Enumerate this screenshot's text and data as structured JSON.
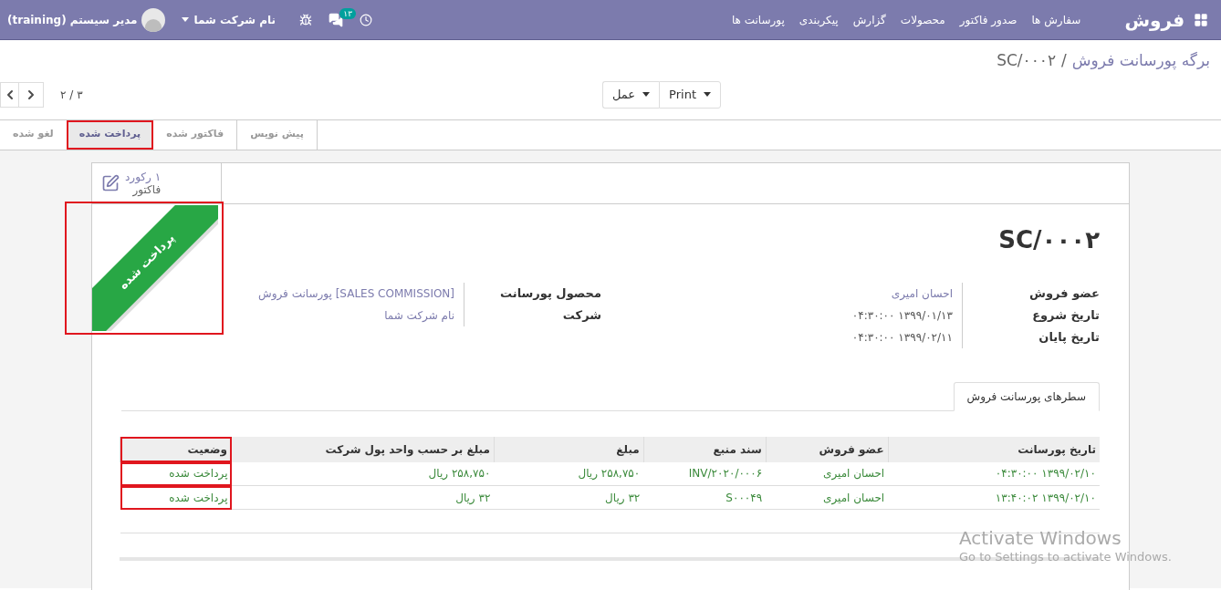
{
  "navbar": {
    "brand": "فروش",
    "menu": [
      "سفارش ها",
      "صدور فاکتور",
      "محصولات",
      "گزارش",
      "پیکربندی",
      "پورسانت ها"
    ],
    "messages_count": "۱۳",
    "company": "نام شرکت شما",
    "user": "مدیر سیستم (training)"
  },
  "breadcrumb": {
    "parent": "برگه پورسانت فروش",
    "separator": "/",
    "current": "SC/۰۰۰۲"
  },
  "actions": [
    {
      "label": "Print"
    },
    {
      "label": "عمل"
    }
  ],
  "pager": {
    "text": "۳ / ۲"
  },
  "status_steps": [
    {
      "label": "پیش نویس",
      "selected": false,
      "highlighted": false
    },
    {
      "label": "فاکتور شده",
      "selected": false,
      "highlighted": false
    },
    {
      "label": "پرداخت شده",
      "selected": true,
      "highlighted": true
    },
    {
      "label": "لغو شده",
      "selected": false,
      "highlighted": false
    }
  ],
  "smart_button": {
    "count": "۱ رکورد",
    "label": "فاکتور"
  },
  "ribbon": {
    "text": "پرداخت شده",
    "highlighted": true
  },
  "title": "SC/۰۰۰۲",
  "fields_right": [
    {
      "label": "عضو فروش",
      "value": "احسان امیری",
      "kind": "link"
    },
    {
      "label": "تاریخ شروع",
      "value": "۱۳۹۹/۰۱/۱۳ ۰۴:۳۰:۰۰",
      "kind": "text"
    },
    {
      "label": "تاریخ پایان",
      "value": "۱۳۹۹/۰۲/۱۱ ۰۴:۳۰:۰۰",
      "kind": "text"
    }
  ],
  "fields_left": [
    {
      "label": "محصول پورسانت",
      "value": "[SALES COMMISSION] پورسانت فروش",
      "kind": "link"
    },
    {
      "label": "شرکت",
      "value": "نام شرکت شما",
      "kind": "link"
    }
  ],
  "notebook_tabs": [
    {
      "label": "سطرهای پورسانت فروش",
      "selected": true
    }
  ],
  "table": {
    "columns": [
      {
        "label": "تاریخ پورسانت",
        "highlighted": false
      },
      {
        "label": "عضو فروش",
        "highlighted": false
      },
      {
        "label": "سند منبع",
        "highlighted": false
      },
      {
        "label": "مبلغ",
        "highlighted": false
      },
      {
        "label": "مبلغ بر حسب واحد پول شرکت",
        "highlighted": false
      },
      {
        "label": "وضعیت",
        "highlighted": true
      }
    ],
    "rows": [
      [
        "۱۳۹۹/۰۲/۱۰ ۰۴:۳۰:۰۰",
        "احسان امیری",
        "INV/۲۰۲۰/۰۰۰۶",
        "۲۵۸,۷۵۰ ریال",
        "۲۵۸,۷۵۰ ریال",
        "پرداخت شده"
      ],
      [
        "۱۳۹۹/۰۲/۱۰ ۱۳:۴۰:۰۲",
        "احسان امیری",
        "S۰۰۰۴۹",
        "۳۲ ریال",
        "۳۲ ریال",
        "پرداخت شده"
      ]
    ]
  },
  "os_notice": {
    "title": "Activate Windows",
    "subtitle": "Go to Settings to activate Windows."
  }
}
